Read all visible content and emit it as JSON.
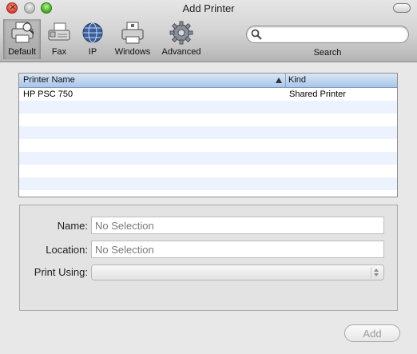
{
  "window": {
    "title": "Add Printer"
  },
  "toolbar": {
    "items": [
      {
        "label": "Default",
        "icon": "printer-default-icon",
        "selected": true
      },
      {
        "label": "Fax",
        "icon": "fax-icon",
        "selected": false
      },
      {
        "label": "IP",
        "icon": "globe-icon",
        "selected": false
      },
      {
        "label": "Windows",
        "icon": "windows-printer-icon",
        "selected": false
      },
      {
        "label": "Advanced",
        "icon": "gear-icon",
        "selected": false
      }
    ],
    "search_label": "Search",
    "search_value": ""
  },
  "table": {
    "columns": {
      "name": "Printer Name",
      "kind": "Kind"
    },
    "sort_column": "Printer Name",
    "rows": [
      {
        "name": "HP PSC 750",
        "kind": "Shared Printer"
      }
    ]
  },
  "form": {
    "name_label": "Name:",
    "name_value": "No Selection",
    "location_label": "Location:",
    "location_value": "No Selection",
    "print_using_label": "Print Using:",
    "print_using_value": ""
  },
  "buttons": {
    "add_label": "Add"
  },
  "colors": {
    "header_blue": "#a9c5ea",
    "stripe_blue": "#edf3fe",
    "close_red": "#d23f2a",
    "zoom_green": "#3fa61f"
  }
}
